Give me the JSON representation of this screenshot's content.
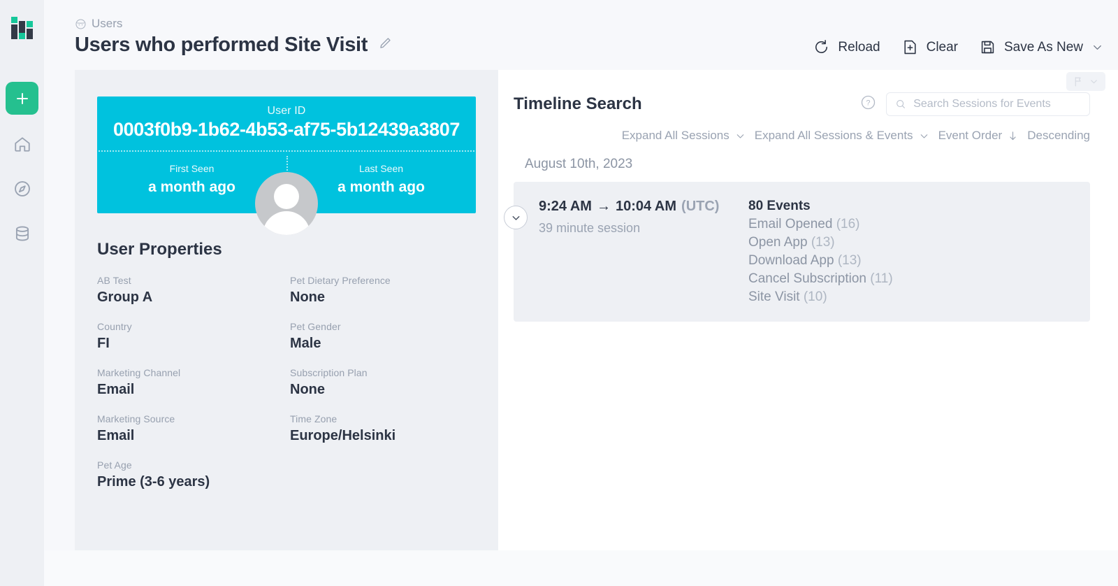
{
  "colors": {
    "accent_cyan": "#00c2de",
    "accent_green": "#25c08f",
    "panel_gray": "#eef0f4",
    "text_dark": "#2c3444",
    "text_muted": "#9aa3b2"
  },
  "rail": {
    "logo_name": "app-logo",
    "items": [
      {
        "name": "add-button",
        "icon": "plus-icon"
      },
      {
        "name": "home-nav",
        "icon": "home-icon"
      },
      {
        "name": "explore-nav",
        "icon": "compass-icon"
      },
      {
        "name": "data-nav",
        "icon": "database-icon"
      }
    ]
  },
  "header": {
    "breadcrumb": "Users",
    "breadcrumb_icon": "user-face-icon",
    "title": "Users who performed Site Visit",
    "edit_icon": "pencil-icon",
    "actions": [
      {
        "label": "Reload",
        "icon": "reload-icon"
      },
      {
        "label": "Clear",
        "icon": "file-plus-icon"
      },
      {
        "label": "Save As New",
        "icon": "save-disk-icon",
        "chevron": "chevron-down-icon"
      }
    ]
  },
  "user_card": {
    "id_label": "User ID",
    "id_value": "0003f0b9-1b62-4b53-af75-5b12439a3807",
    "first_seen_label": "First Seen",
    "first_seen_value": "a month ago",
    "last_seen_label": "Last Seen",
    "last_seen_value": "a month ago",
    "avatar_icon": "avatar-placeholder-icon"
  },
  "user_properties": {
    "title": "User Properties",
    "items": [
      {
        "label": "AB Test",
        "value": "Group A"
      },
      {
        "label": "Pet Dietary Preference",
        "value": "None"
      },
      {
        "label": "Country",
        "value": "FI"
      },
      {
        "label": "Pet Gender",
        "value": "Male"
      },
      {
        "label": "Marketing Channel",
        "value": "Email"
      },
      {
        "label": "Subscription Plan",
        "value": "None"
      },
      {
        "label": "Marketing Source",
        "value": "Email"
      },
      {
        "label": "Time Zone",
        "value": "Europe/Helsinki"
      },
      {
        "label": "Pet Age",
        "value": "Prime (3-6 years)"
      }
    ]
  },
  "timeline": {
    "title": "Timeline Search",
    "help_icon": "question-circle-icon",
    "flag_icon": "flag-icon",
    "flag_chevron_icon": "chevron-down-icon",
    "search": {
      "placeholder": "Search Sessions for Events",
      "value": "",
      "icon": "search-icon"
    },
    "controls": [
      {
        "label": "Expand All Sessions",
        "icon": "chevron-down-icon",
        "name": "expand-all-sessions"
      },
      {
        "label": "Expand All Sessions & Events",
        "icon": "chevron-down-icon",
        "name": "expand-all-sessions-events"
      },
      {
        "label": "Event Order",
        "icon": "arrow-down-icon",
        "name": "event-order"
      },
      {
        "label": "Descending",
        "icon": "",
        "name": "sort-direction"
      }
    ],
    "date_group": "August 10th, 2023",
    "session": {
      "expand_icon": "chevron-down-circle-icon",
      "start_time": "9:24 AM",
      "arrow": "→",
      "end_time": "10:04 AM",
      "timezone": "(UTC)",
      "duration": "39 minute session",
      "event_total": "80 Events",
      "events": [
        {
          "name": "Email Opened",
          "count": "(16)"
        },
        {
          "name": "Open App",
          "count": "(13)"
        },
        {
          "name": "Download App",
          "count": "(13)"
        },
        {
          "name": "Cancel Subscription",
          "count": "(11)"
        },
        {
          "name": "Site Visit",
          "count": "(10)"
        }
      ]
    }
  }
}
